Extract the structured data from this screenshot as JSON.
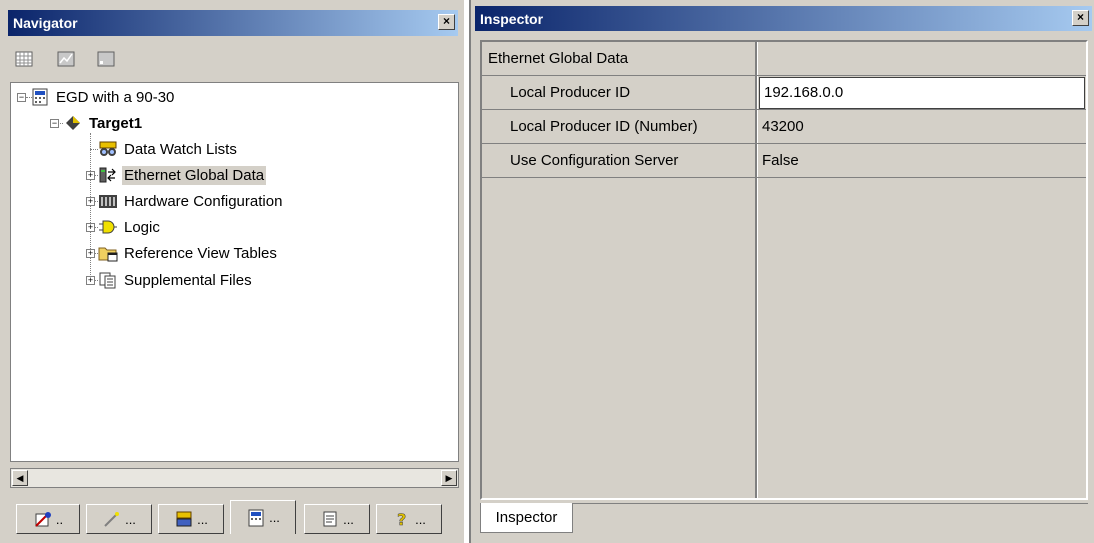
{
  "navigator": {
    "title": "Navigator",
    "close_glyph": "×",
    "toolbar_icons": [
      "grid-view-icon",
      "chart-view-icon",
      "blank-view-icon"
    ],
    "tree": [
      {
        "label": "EGD with a 90-30",
        "icon": "project-icon",
        "bold": false,
        "level": 0
      },
      {
        "label": "Target1",
        "icon": "target-diamond-icon",
        "bold": true,
        "level": 1
      },
      {
        "label": "Data Watch Lists",
        "icon": "watch-list-icon",
        "bold": false,
        "level": 2
      },
      {
        "label": "Ethernet Global Data",
        "icon": "ethernet-icon",
        "bold": false,
        "level": 2,
        "selected": true
      },
      {
        "label": "Hardware Configuration",
        "icon": "hardware-icon",
        "bold": false,
        "level": 2
      },
      {
        "label": "Logic",
        "icon": "logic-gate-icon",
        "bold": false,
        "level": 2
      },
      {
        "label": "Reference View Tables",
        "icon": "folder-table-icon",
        "bold": false,
        "level": 2
      },
      {
        "label": "Supplemental Files",
        "icon": "files-icon",
        "bold": false,
        "level": 2
      }
    ],
    "tabs": [
      {
        "label": "..",
        "icon": "options-icon"
      },
      {
        "label": "...",
        "icon": "wand-icon"
      },
      {
        "label": "...",
        "icon": "data-watch-icon"
      },
      {
        "label": "...",
        "icon": "project-icon",
        "active": true
      },
      {
        "label": "...",
        "icon": "scroll-icon"
      },
      {
        "label": "...",
        "icon": "help-icon"
      }
    ]
  },
  "inspector": {
    "title": "Inspector",
    "close_glyph": "×",
    "rows": [
      {
        "key": "Ethernet Global Data",
        "value": "",
        "indent": false
      },
      {
        "key": "Local Producer ID",
        "value": "192.168.0.0",
        "indent": true,
        "editing": true
      },
      {
        "key": "Local Producer ID (Number)",
        "value": "43200",
        "indent": true
      },
      {
        "key": "Use Configuration Server",
        "value": "False",
        "indent": true
      }
    ],
    "tab_label": "Inspector"
  }
}
